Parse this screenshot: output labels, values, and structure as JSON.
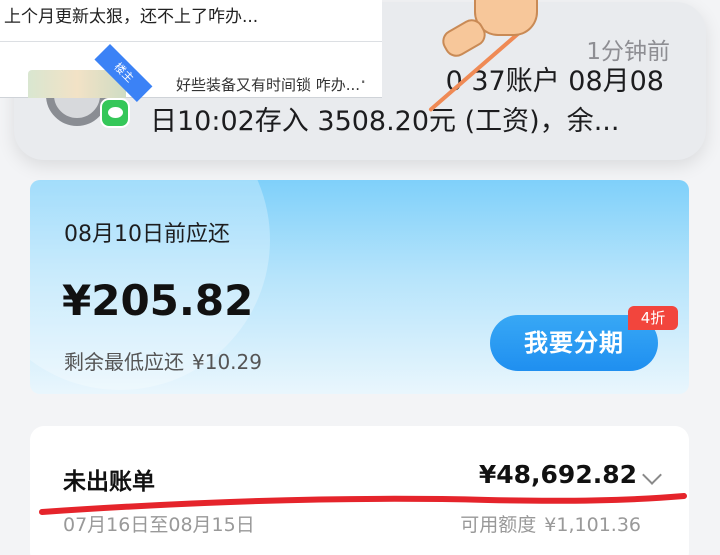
{
  "overlay": {
    "title": "上个月更新太狠，还不上了咋办...",
    "ribbon": "楼主",
    "message": "好些装备又有时间锁 咋办...",
    "tail": "·"
  },
  "notification": {
    "time": "1分钟前",
    "body_line1": "0 37账户 08月08",
    "body_line2": "日10:02存入 3508.20元 (工资)，余..."
  },
  "repayment": {
    "due_label": "08月10日前应还",
    "amount": "¥205.82",
    "min_label": "剩余最低应还",
    "min_value": "¥10.29",
    "installment_button": "我要分期",
    "discount_tag": "4折"
  },
  "unbilled": {
    "title": "未出账单",
    "amount": "¥48,692.82",
    "period": "07月16日至08月15日",
    "available_label": "可用额度",
    "available_value": "¥1,101.36"
  },
  "colors": {
    "accent": "#1f8ff0",
    "tag_red": "#f2453d",
    "annotation_red": "#e5242b"
  }
}
